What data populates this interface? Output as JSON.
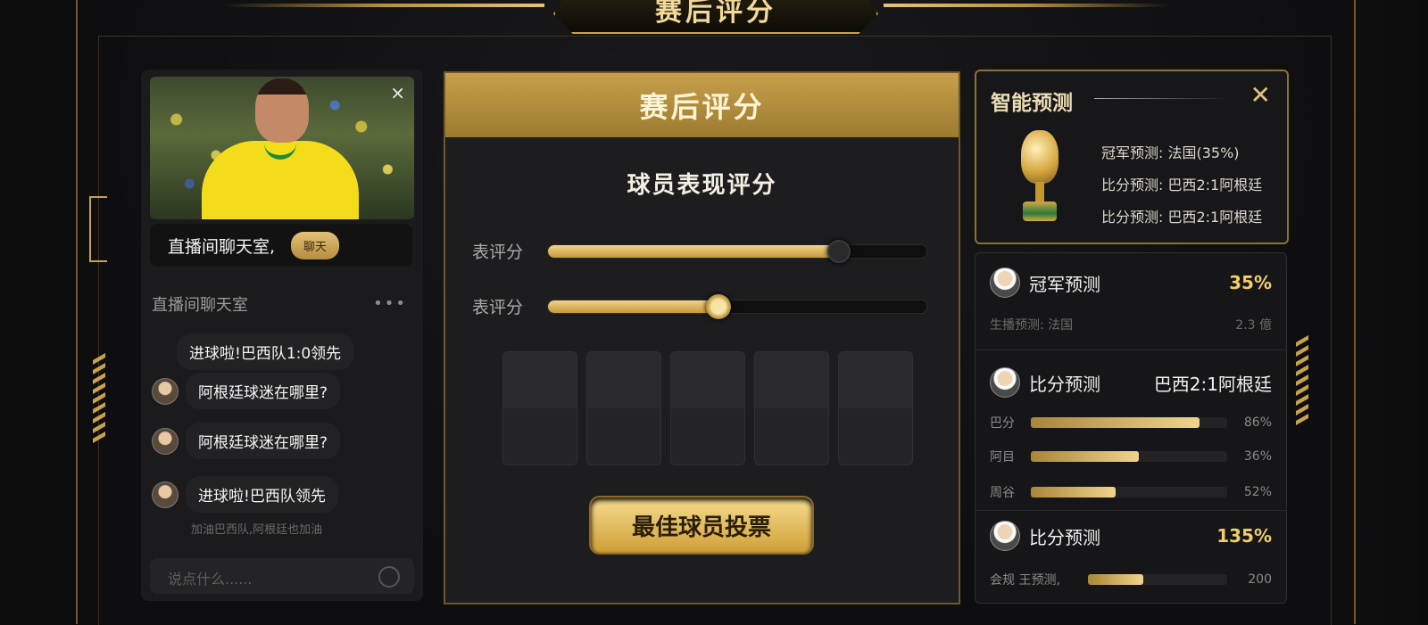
{
  "top_banner": {
    "title": "赛后评分"
  },
  "chat": {
    "close_label": "×",
    "title_bar_text": "直播间聊天室,",
    "title_bar_button": "聊天",
    "sub_title": "直播间聊天室",
    "more_label": "•••",
    "messages": [
      {
        "text": "进球啦!巴西队1:0领先",
        "avatar": false
      },
      {
        "text": "阿根廷球迷在哪里?",
        "avatar": true
      },
      {
        "text": "阿根廷球迷在哪里?",
        "avatar": true
      },
      {
        "text": "进球啦!巴西队领先",
        "avatar": true
      }
    ],
    "faded_line": "加油巴西队,阿根廷也加油",
    "input_placeholder": "说点什么......"
  },
  "rating": {
    "header": "赛后评分",
    "section_title": "球员表现评分",
    "sliders": [
      {
        "label": "表评分",
        "value": 0.77
      },
      {
        "label": "表评分",
        "value": 0.45
      }
    ],
    "vote_button": "最佳球员投票"
  },
  "prediction": {
    "title": "智能预测",
    "close_label": "✕",
    "lines": [
      "冠军预测: 法国(35%)",
      "比分预测: 巴西2:1阿根廷",
      "比分预测: 巴西2:1阿根廷"
    ]
  },
  "stats": {
    "champion": {
      "name": "冠军预测",
      "value": "35%",
      "sub_left": "生播预测: 法国",
      "sub_right": "2.3 億"
    },
    "score": {
      "name": "比分预测",
      "value": "巴西2:1阿根廷",
      "bars": [
        {
          "label": "巴分",
          "value": 0.86,
          "text": "86%"
        },
        {
          "label": "阿目",
          "value": 0.55,
          "text": "36%"
        },
        {
          "label": "周谷",
          "value": 0.43,
          "text": "52%"
        }
      ]
    },
    "third": {
      "name": "比分预测",
      "value": "135%",
      "bar_label": "会规 王预测,",
      "bar_value": 0.4,
      "bar_text": "200"
    }
  }
}
